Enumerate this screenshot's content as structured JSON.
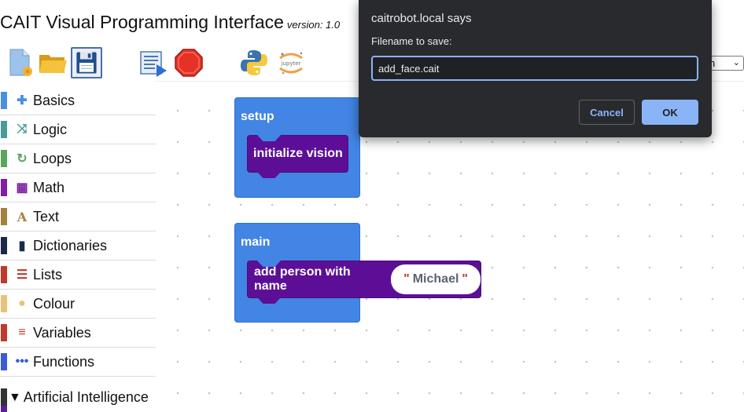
{
  "app": {
    "title": "CAIT Visual Programming Interface",
    "version": "version: 1.0"
  },
  "toolbar": {
    "icons": [
      "new-file-icon",
      "open-folder-icon",
      "save-icon",
      "run-icon",
      "stop-icon",
      "python-icon",
      "jupyter-icon"
    ],
    "jupyter_label": "jupyter",
    "select_value": "n"
  },
  "toolbox": {
    "categories": [
      {
        "label": "Basics",
        "color": "#4a90e2",
        "icon": "puzzle-icon"
      },
      {
        "label": "Logic",
        "color": "#4a9a9a",
        "icon": "shuffle-icon"
      },
      {
        "label": "Loops",
        "color": "#5ba55b",
        "icon": "loop-icon"
      },
      {
        "label": "Math",
        "color": "#7e1fa6",
        "icon": "calculator-icon"
      },
      {
        "label": "Text",
        "color": "#a5823c",
        "icon": "text-icon"
      },
      {
        "label": "Dictionaries",
        "color": "#1a2a4a",
        "icon": "book-icon"
      },
      {
        "label": "Lists",
        "color": "#c0392b",
        "icon": "list-icon"
      },
      {
        "label": "Colour",
        "color": "#e8c27a",
        "icon": "palette-icon"
      },
      {
        "label": "Variables",
        "color": "#c0392b",
        "icon": "variables-icon"
      },
      {
        "label": "Functions",
        "color": "#3b5bd6",
        "icon": "functions-icon"
      }
    ],
    "ai_section": {
      "label": "Artificial Intelligence",
      "arrow": "▼"
    }
  },
  "blocks": {
    "setup": {
      "title": "setup",
      "child": "initialize vision"
    },
    "main": {
      "title": "main",
      "child": "add person with name",
      "arg": "Michael"
    }
  },
  "dialog": {
    "title": "caitrobot.local says",
    "prompt": "Filename to save:",
    "input_value": "add_face.cait",
    "cancel_label": "Cancel",
    "ok_label": "OK"
  },
  "colors": {
    "block_blue": "#4285e4",
    "block_purple": "#5c0f96",
    "dialog_bg": "#292a2d",
    "dialog_accent": "#8ab4f8"
  }
}
